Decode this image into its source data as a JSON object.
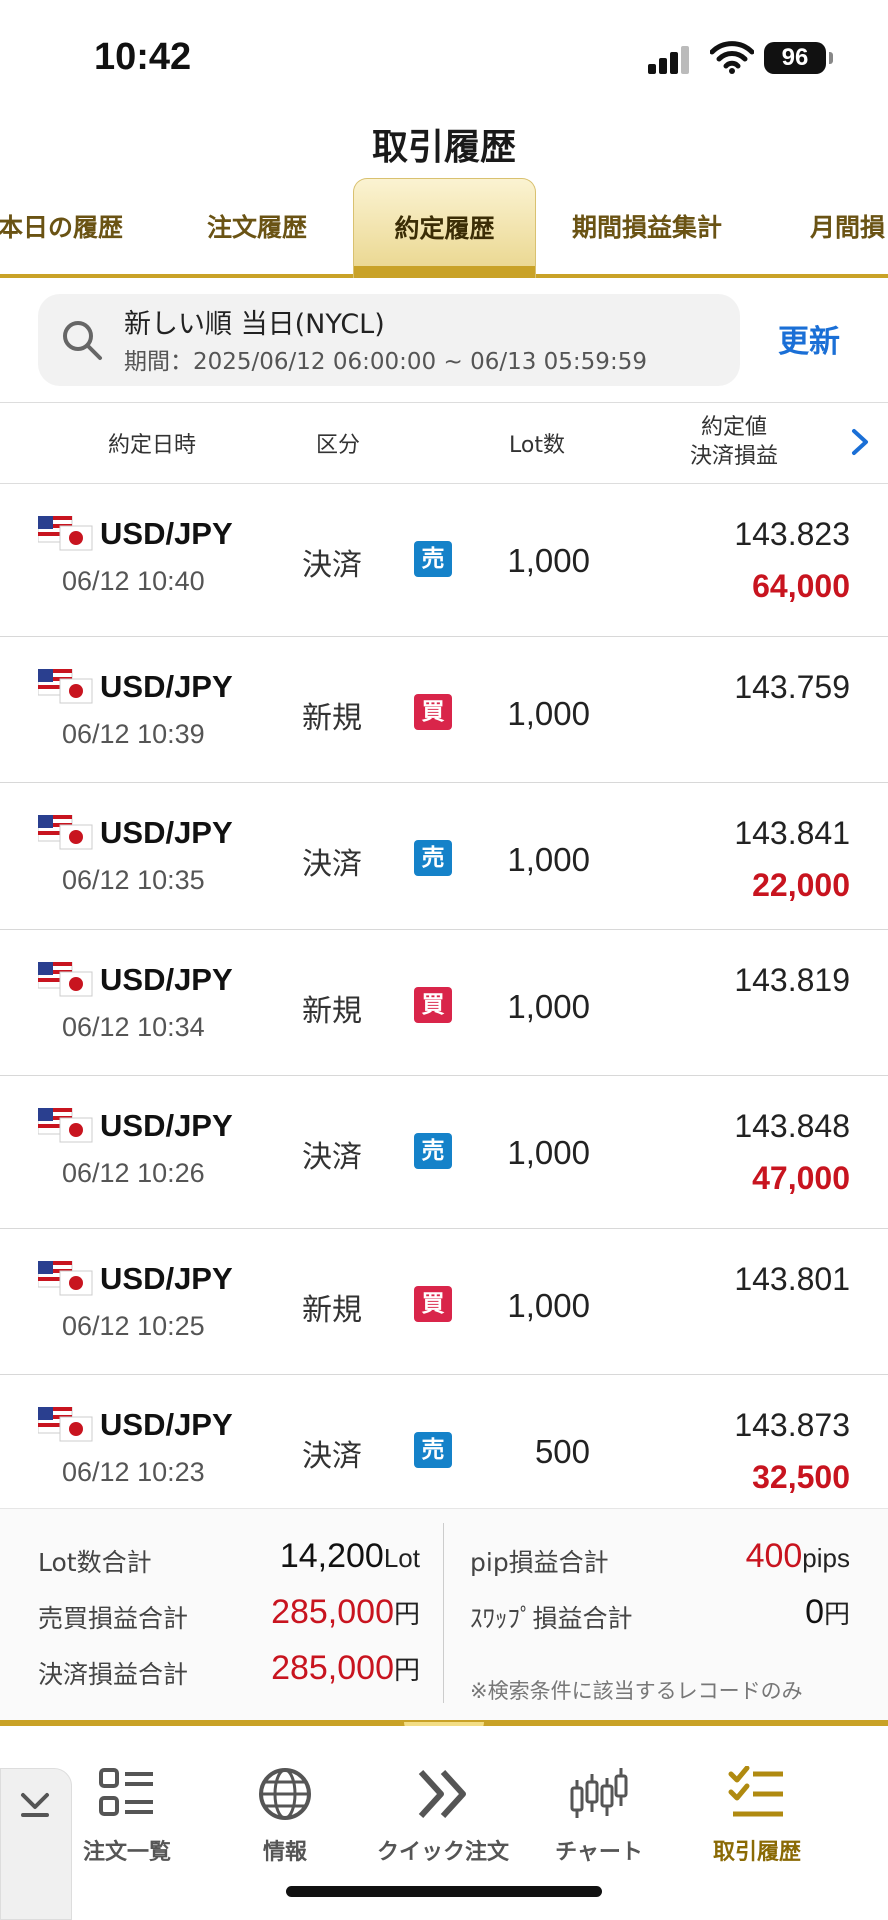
{
  "status_bar": {
    "time": "10:42",
    "battery": "96"
  },
  "header": {
    "title": "取引履歴"
  },
  "tabs": [
    {
      "label": "本日の履歴"
    },
    {
      "label": "注文履歴"
    },
    {
      "label": "約定履歴"
    },
    {
      "label": "期間損益集計"
    },
    {
      "label": "月間損"
    }
  ],
  "search": {
    "line1": "新しい順 当日(NYCL)",
    "line2": "期間：2025/06/12 06:00:00 ~ 06/13 05:59:59",
    "refresh_label": "更新"
  },
  "columns": {
    "datetime": "約定日時",
    "kind": "区分",
    "lot": "Lot数",
    "price": "約定値",
    "pl": "決済損益"
  },
  "rows": [
    {
      "pair": "USD/JPY",
      "datetime": "06/12 10:40",
      "kind": "決済",
      "side": "売",
      "lot": "1,000",
      "price": "143.823",
      "pl": "64,000"
    },
    {
      "pair": "USD/JPY",
      "datetime": "06/12 10:39",
      "kind": "新規",
      "side": "買",
      "lot": "1,000",
      "price": "143.759",
      "pl": ""
    },
    {
      "pair": "USD/JPY",
      "datetime": "06/12 10:35",
      "kind": "決済",
      "side": "売",
      "lot": "1,000",
      "price": "143.841",
      "pl": "22,000"
    },
    {
      "pair": "USD/JPY",
      "datetime": "06/12 10:34",
      "kind": "新規",
      "side": "買",
      "lot": "1,000",
      "price": "143.819",
      "pl": ""
    },
    {
      "pair": "USD/JPY",
      "datetime": "06/12 10:26",
      "kind": "決済",
      "side": "売",
      "lot": "1,000",
      "price": "143.848",
      "pl": "47,000"
    },
    {
      "pair": "USD/JPY",
      "datetime": "06/12 10:25",
      "kind": "新規",
      "side": "買",
      "lot": "1,000",
      "price": "143.801",
      "pl": ""
    },
    {
      "pair": "USD/JPY",
      "datetime": "06/12 10:23",
      "kind": "決済",
      "side": "売",
      "lot": "500",
      "price": "143.873",
      "pl": "32,500"
    }
  ],
  "summary": {
    "lot_total_label": "Lot数合計",
    "lot_total_value": "14,200",
    "lot_total_unit": "Lot",
    "trade_pl_label": "売買損益合計",
    "trade_pl_value": "285,000",
    "trade_pl_unit": "円",
    "settle_pl_label": "決済損益合計",
    "settle_pl_value": "285,000",
    "settle_pl_unit": "円",
    "pip_pl_label": "pip損益合計",
    "pip_pl_value": "400",
    "pip_pl_unit": "pips",
    "swap_pl_label": "ｽﾜｯﾌﾟ損益合計",
    "swap_pl_value": "0",
    "swap_pl_unit": "円",
    "note": "※検索条件に該当するレコードのみ"
  },
  "nav": [
    {
      "label": "注文一覧",
      "icon": "list-icon"
    },
    {
      "label": "情報",
      "icon": "globe-icon"
    },
    {
      "label": "クイック注文",
      "icon": "double-chevron-icon"
    },
    {
      "label": "チャート",
      "icon": "candlestick-icon"
    },
    {
      "label": "取引履歴",
      "icon": "checklist-icon"
    }
  ],
  "colors": {
    "accent_gold": "#c9a227",
    "sell_blue": "#1582c9",
    "buy_red": "#d9254a",
    "profit_red": "#c8141f",
    "link_blue": "#1a6fd6"
  }
}
